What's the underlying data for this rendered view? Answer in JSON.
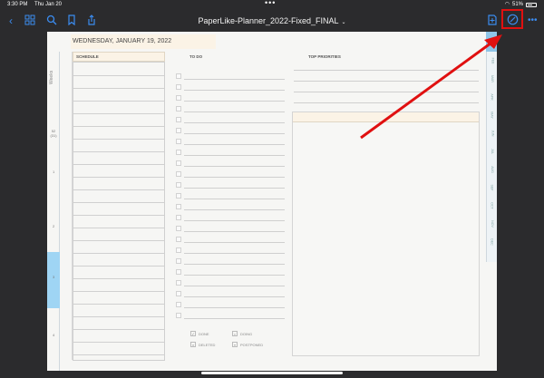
{
  "status": {
    "time": "3:30 PM",
    "date": "Thu Jan 20",
    "battery": "51%"
  },
  "toolbar": {
    "title": "PaperLike-Planner_2022-Fixed_FINAL",
    "more": "•••"
  },
  "page": {
    "date_header": "WEDNESDAY, JANUARY 19, 2022",
    "weeks_label": "Weeks",
    "week_number": "52 (31)",
    "hours": [
      "1",
      "2",
      "3",
      "4"
    ],
    "schedule_title": "SCHEDULE",
    "todo_title": "TO DO",
    "priorities_title": "TOP PRIORITIES",
    "months": [
      "FEB",
      "MAR",
      "APR",
      "MAY",
      "JUN",
      "JUL",
      "AUG",
      "SEP",
      "OCT",
      "NOV",
      "DEC"
    ],
    "legend": {
      "done": "DONE",
      "doing": "DOING",
      "deleted": "DELETED",
      "postponed": "POSTPONED"
    }
  },
  "colors": {
    "accent": "#3b8cf0",
    "highlight": "#e01010",
    "arrow": "#e01010",
    "tab_active": "#9fd5f4"
  },
  "icons": [
    "sidebar-icon",
    "grid-icon",
    "search-icon",
    "bookmark-icon",
    "share-icon",
    "add-page-icon",
    "pencil-circle-icon",
    "more-icon"
  ]
}
